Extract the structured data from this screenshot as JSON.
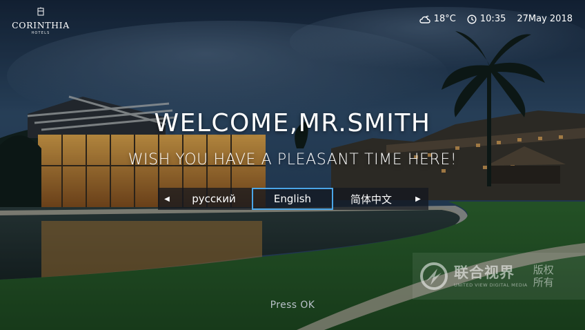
{
  "brand": {
    "name": "CORINTHIA",
    "sub": "HOTELS"
  },
  "status": {
    "weather_icon": "cloud-icon",
    "temperature": "18°C",
    "clock_icon": "clock-icon",
    "time": "10:35",
    "date": "27May 2018"
  },
  "welcome": {
    "title": "WELCOME,MR.SMITH",
    "subtitle": "WISH YOU HAVE A PLEASANT TIME HERE!"
  },
  "languages": {
    "options": [
      "русский",
      "English",
      "简体中文"
    ],
    "selected": "English",
    "prev_icon": "arrow-left-icon",
    "next_icon": "arrow-right-icon"
  },
  "footer": {
    "hint": "Press OK"
  },
  "watermark": {
    "cn": "联合视界",
    "en": "UNITED VIEW DIGITAL MEDIA",
    "rights": "版权所有"
  },
  "colors": {
    "focus": "#4aa6e8",
    "overlay": "#12161e"
  }
}
